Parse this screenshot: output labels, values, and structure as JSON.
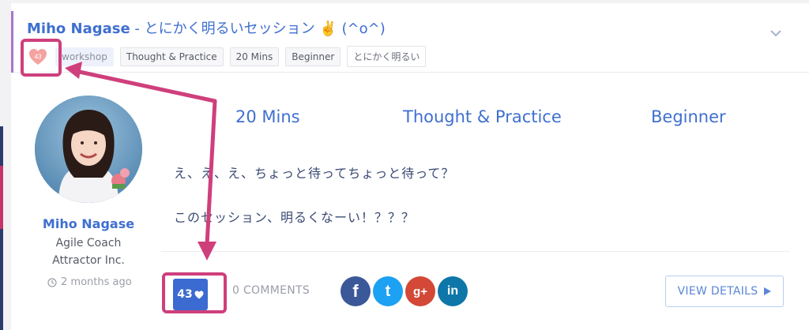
{
  "session": {
    "speaker": "Miho Nagase",
    "separator": " - ",
    "title": "とにかく明るいセッション ✌️ (^o^)",
    "tags": [
      "workshop",
      "Thought & Practice",
      "20 Mins",
      "Beginner",
      "とにかく明るい"
    ],
    "like_count_small": "43"
  },
  "meta": {
    "duration": "20 Mins",
    "track": "Thought & Practice",
    "level": "Beginner"
  },
  "description": {
    "line1": "え、え、え、ちょっと待ってちょっと待って？",
    "line2": "このセッション、明るくなーい！？？？"
  },
  "profile": {
    "name": "Miho Nagase",
    "role": "Agile Coach",
    "company": "Attractor Inc.",
    "time": "2 months ago"
  },
  "footer": {
    "likes": "43",
    "comments": "0 COMMENTS",
    "view_details": "VIEW DETAILS"
  },
  "social": [
    {
      "icon": "facebook-icon",
      "glyph": "f",
      "color": "#3b5998"
    },
    {
      "icon": "twitter-icon",
      "glyph": "t",
      "color": "#1da1f2"
    },
    {
      "icon": "google-plus-icon",
      "glyph": "g+",
      "color": "#d34836"
    },
    {
      "icon": "linkedin-icon",
      "glyph": "in",
      "color": "#0e76a8"
    }
  ],
  "colors": {
    "accent": "#3f6fd0",
    "highlight": "#cf3f7c"
  }
}
